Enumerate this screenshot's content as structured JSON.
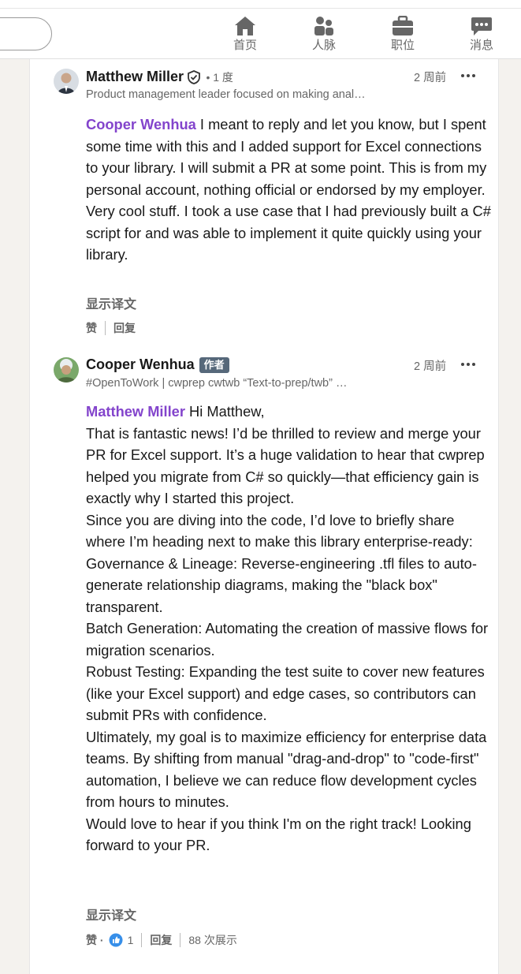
{
  "nav": {
    "items": [
      {
        "label": "首页",
        "icon": "home-icon"
      },
      {
        "label": "人脉",
        "icon": "network-icon"
      },
      {
        "label": "职位",
        "icon": "jobs-briefcase-icon"
      },
      {
        "label": "消息",
        "icon": "messaging-icon"
      }
    ]
  },
  "comments": [
    {
      "author": "Matthew Miller",
      "degree": "• 1 度",
      "headline": "Product management leader focused on making anal…",
      "time": "2 周前",
      "mention": "Cooper Wenhua",
      "body": [
        " I meant to reply and let you know, but I spent some time with this and I added support for Excel connections to your library. I will submit a PR at some point. This is from my personal account, nothing official or endorsed by my employer. Very cool stuff. I took a use case that I had previously built a C# script for and was able to implement it quite quickly using your library."
      ],
      "translate": "显示译文",
      "like": "赞",
      "reply": "回复"
    },
    {
      "author": "Cooper Wenhua",
      "badge": "作者",
      "headline": "#OpenToWork | cwprep cwtwb “Text-to-prep/twb” …",
      "time": "2 周前",
      "mention": "Matthew Miller",
      "body": [
        " Hi Matthew,",
        "That is fantastic news! I’d be thrilled to review and merge your PR for Excel support. It’s a huge validation to hear that cwprep helped you migrate from C# so quickly—that efficiency gain is exactly why I started this project.",
        "Since you are diving into the code, I’d love to briefly share where I’m heading next to make this library enterprise-ready:",
        "Governance & Lineage: Reverse-engineering .tfl files to auto-generate relationship diagrams, making the \"black box\" transparent.",
        "Batch Generation: Automating the creation of massive flows for migration scenarios.",
        "Robust Testing: Expanding the test suite to cover new features (like your Excel support) and edge cases, so contributors can submit PRs with confidence.",
        "Ultimately, my goal is to maximize efficiency for enterprise data teams. By shifting from manual \"drag-and-drop\" to \"code-first\" automation, I believe we can reduce flow development cycles from hours to minutes.",
        "Would love to hear if you think I'm on the right track! Looking forward to your PR."
      ],
      "translate": "显示译文",
      "like": "赞 ·",
      "reaction_count": "1",
      "reply": "回复",
      "views": "88 次展示"
    }
  ],
  "colors": {
    "mention": "#8344cc",
    "badge": "#56687a",
    "like_blue": "#378fe9"
  }
}
